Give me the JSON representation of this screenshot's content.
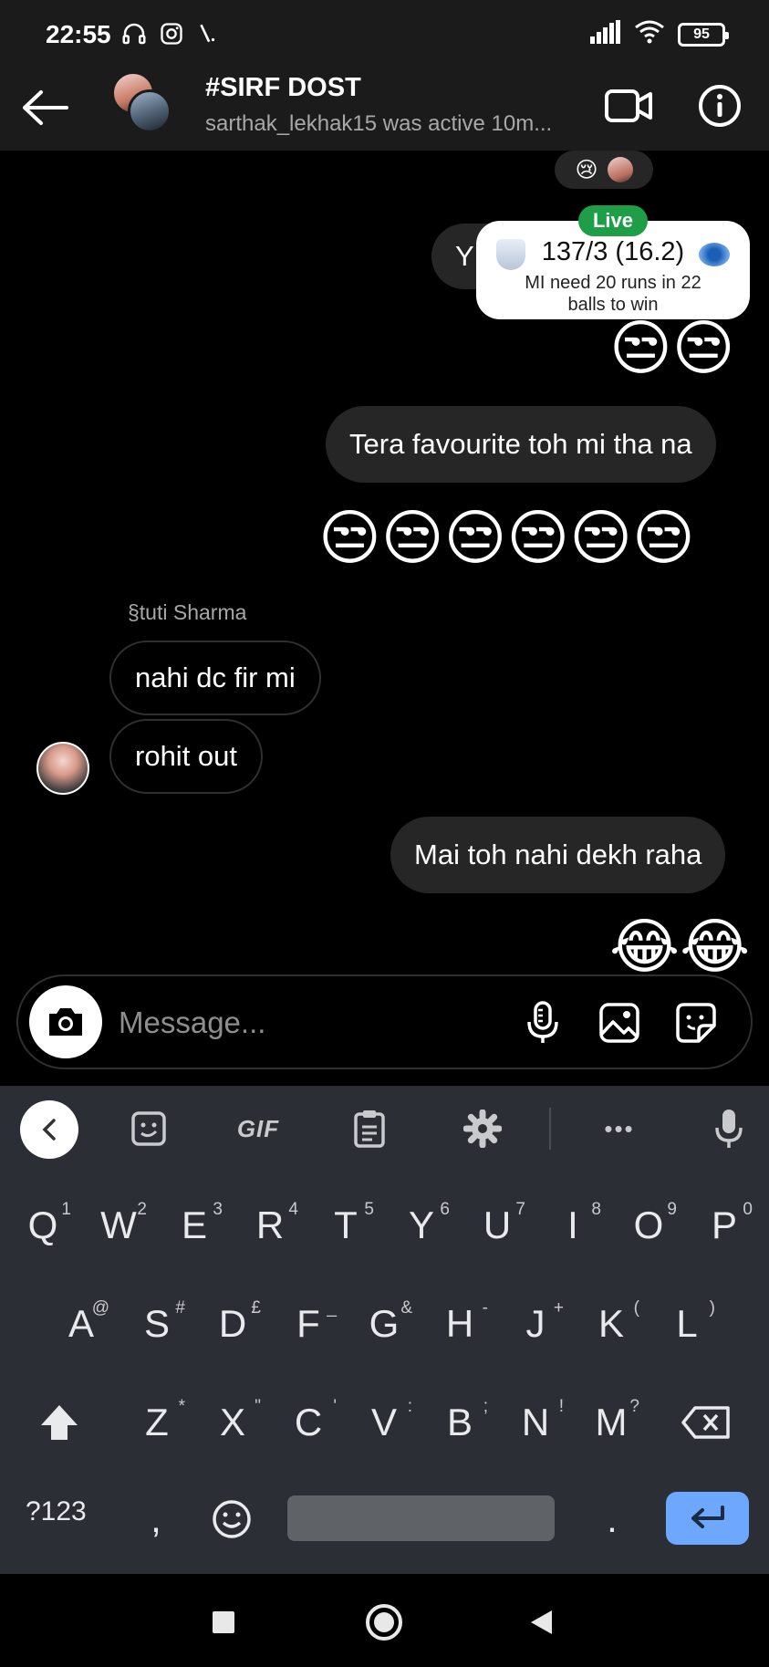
{
  "status_bar": {
    "time": "22:55",
    "battery": "95",
    "left_icons": [
      "headphones-icon",
      "instagram-icon",
      "signal-slash-icon"
    ],
    "right_icons": [
      "cell-signal-icon",
      "wifi-icon",
      "battery-icon"
    ]
  },
  "header": {
    "title": "#SIRF DOST",
    "subtitle": "sarthak_lekhak15 was active 10m..."
  },
  "reaction": {
    "emoji": "😢"
  },
  "live_score": {
    "badge": "Live",
    "score": "137/3 (16.2)",
    "status": "MI need 20 runs in 22 balls to win",
    "hidden_bubble_text": "Y"
  },
  "messages": {
    "emoji_row_1": "😒😒",
    "bubble_1": "Tera favourite toh mi tha na",
    "emoji_row_2": "😒😒😒😒😒😒",
    "sender_name": "§tuti Sharma",
    "in_1": "nahi dc fir mi",
    "in_2": "rohit out",
    "bubble_2": "Mai toh nahi dekh raha",
    "emoji_row_3": "😂😂"
  },
  "composer": {
    "placeholder": "Message..."
  },
  "keyboard": {
    "toolbar": {
      "gif_label": "GIF",
      "more_label": "•••"
    },
    "row1": [
      {
        "key": "Q",
        "hint": "1"
      },
      {
        "key": "W",
        "hint": "2"
      },
      {
        "key": "E",
        "hint": "3"
      },
      {
        "key": "R",
        "hint": "4"
      },
      {
        "key": "T",
        "hint": "5"
      },
      {
        "key": "Y",
        "hint": "6"
      },
      {
        "key": "U",
        "hint": "7"
      },
      {
        "key": "I",
        "hint": "8"
      },
      {
        "key": "O",
        "hint": "9"
      },
      {
        "key": "P",
        "hint": "0"
      }
    ],
    "row2": [
      {
        "key": "A",
        "hint": "@"
      },
      {
        "key": "S",
        "hint": "#"
      },
      {
        "key": "D",
        "hint": "£"
      },
      {
        "key": "F",
        "hint": "_"
      },
      {
        "key": "G",
        "hint": "&"
      },
      {
        "key": "H",
        "hint": "-"
      },
      {
        "key": "J",
        "hint": "+"
      },
      {
        "key": "K",
        "hint": "("
      },
      {
        "key": "L",
        "hint": ")"
      }
    ],
    "row3": [
      {
        "key": "Z",
        "hint": "*"
      },
      {
        "key": "X",
        "hint": "\""
      },
      {
        "key": "C",
        "hint": "'"
      },
      {
        "key": "V",
        "hint": ":"
      },
      {
        "key": "B",
        "hint": ";"
      },
      {
        "key": "N",
        "hint": "!"
      },
      {
        "key": "M",
        "hint": "?"
      }
    ],
    "symbols_label": "?123",
    "comma": ",",
    "period": "."
  }
}
